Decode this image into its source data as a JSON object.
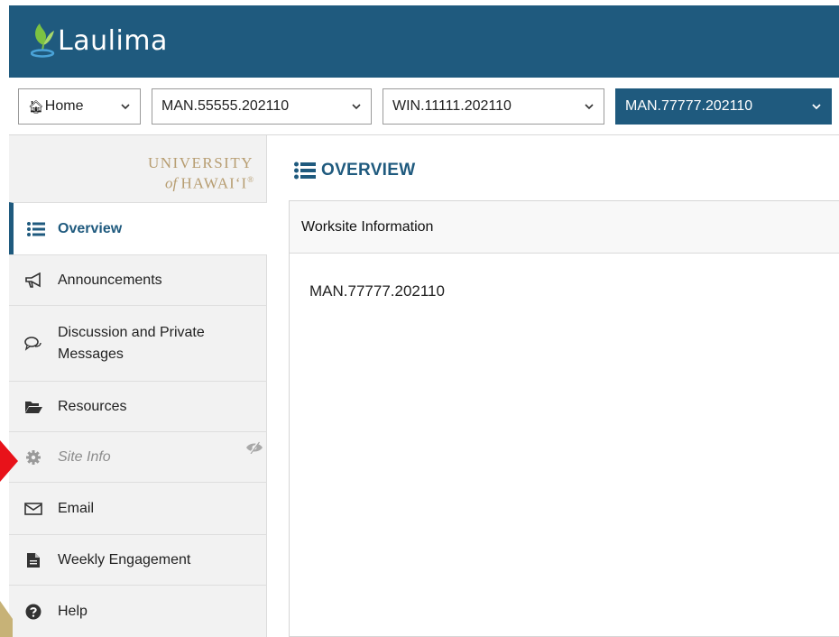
{
  "header": {
    "app_title": "Laulima",
    "logo_icon": "laulima-leaf-icon",
    "bg_color": "#1f5a7e"
  },
  "site_nav": {
    "tabs": [
      {
        "label": "Home",
        "icon": "home-icon",
        "active": false
      },
      {
        "label": "MAN.55555.202110",
        "active": false
      },
      {
        "label": "WIN.11111.202110",
        "active": false
      },
      {
        "label": "MAN.77777.202110",
        "active": true
      }
    ]
  },
  "sidebar": {
    "institution_line1": "UNIVERSITY",
    "institution_line2_a": "of ",
    "institution_line2_b": "HAWAI‘I",
    "institution_mark": "®",
    "tools": [
      {
        "label": "Overview",
        "icon": "list-icon",
        "active": true
      },
      {
        "label": "Announcements",
        "icon": "megaphone-icon"
      },
      {
        "label": "Discussion and Private Messages",
        "label_line1": "Discussion and Private",
        "label_line2": "Messages",
        "icon": "chat-bubbles-icon"
      },
      {
        "label": "Resources",
        "icon": "folder-open-icon"
      },
      {
        "label": "Site Info",
        "icon": "gear-icon",
        "hidden_from_students": true,
        "status_icon": "eye-slash-icon"
      },
      {
        "label": "Email",
        "icon": "envelope-icon"
      },
      {
        "label": "Weekly Engagement",
        "icon": "document-icon"
      },
      {
        "label": "Help",
        "icon": "question-circle-icon"
      }
    ]
  },
  "main": {
    "page_title": "OVERVIEW",
    "title_icon": "list-icon",
    "panel_title": "Worksite Information",
    "panel_content": "MAN.77777.202110"
  },
  "colors": {
    "accent": "#1f5a7e",
    "sidebar_bg": "#f2f2f2",
    "hidden_text": "#8c8c8c",
    "annotation_arrow": "#e8121a"
  }
}
